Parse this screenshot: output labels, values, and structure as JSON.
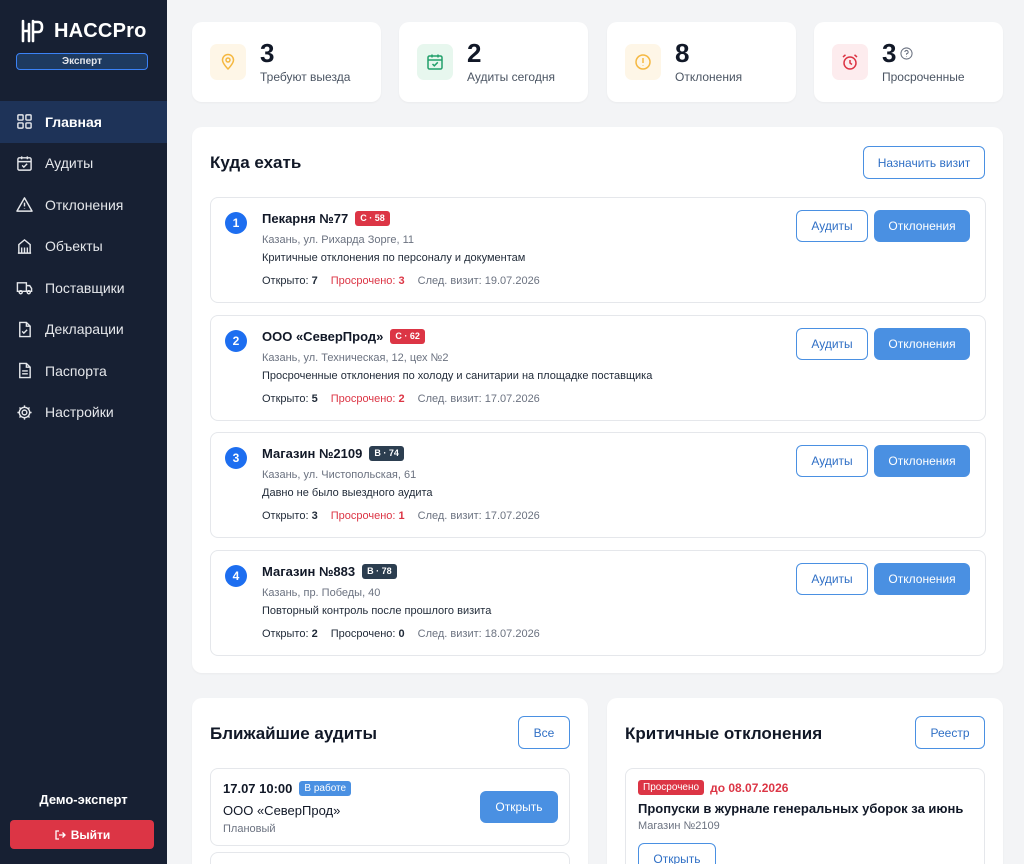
{
  "app": {
    "name": "HACCPro",
    "role": "Эксперт"
  },
  "sidebar": {
    "items": [
      {
        "label": "Главная",
        "icon": "grid-icon",
        "active": true
      },
      {
        "label": "Аудиты",
        "icon": "calendar-check-icon"
      },
      {
        "label": "Отклонения",
        "icon": "warning-icon"
      },
      {
        "label": "Объекты",
        "icon": "building-icon"
      },
      {
        "label": "Поставщики",
        "icon": "truck-icon"
      },
      {
        "label": "Декларации",
        "icon": "document-check-icon"
      },
      {
        "label": "Паспорта",
        "icon": "document-icon"
      },
      {
        "label": "Настройки",
        "icon": "gear-icon"
      }
    ],
    "user_name": "Демо-эксперт",
    "logout_label": "Выйти"
  },
  "stats": [
    {
      "value": "3",
      "label": "Требуют выезда",
      "icon": "map-pin-icon",
      "color": "#f5b841",
      "bg": "#fef6e7"
    },
    {
      "value": "2",
      "label": "Аудиты сегодня",
      "icon": "calendar-check-icon",
      "color": "#22a06b",
      "bg": "#e7f7ee"
    },
    {
      "value": "8",
      "label": "Отклонения",
      "icon": "alert-circle-icon",
      "color": "#f5b841",
      "bg": "#fef6e7"
    },
    {
      "value": "3",
      "label": "Просроченные",
      "icon": "alarm-clock-icon",
      "color": "#dc3545",
      "bg": "#fdecee"
    }
  ],
  "visits_panel": {
    "title": "Куда ехать",
    "assign_label": "Назначить визит",
    "audits_label": "Аудиты",
    "deviations_label": "Отклонения",
    "open_label": "Открыто:",
    "overdue_label": "Просрочено:",
    "next_label": "След. визит:",
    "items": [
      {
        "num": "1",
        "name": "Пекарня №77",
        "grade": "C · 58",
        "grade_class": "c",
        "address": "Казань, ул. Рихарда Зорге, 11",
        "reason": "Критичные отклонения по персоналу и документам",
        "open": "7",
        "overdue": "3",
        "overdue_highlight": true,
        "next": "19.07.2026"
      },
      {
        "num": "2",
        "name": "ООО «СеверПрод»",
        "grade": "C · 62",
        "grade_class": "c",
        "address": "Казань, ул. Техническая, 12, цех №2",
        "reason": "Просроченные отклонения по холоду и санитарии на площадке поставщика",
        "open": "5",
        "overdue": "2",
        "overdue_highlight": true,
        "next": "17.07.2026"
      },
      {
        "num": "3",
        "name": "Магазин №2109",
        "grade": "B · 74",
        "grade_class": "b",
        "address": "Казань, ул. Чистопольская, 61",
        "reason": "Давно не было выездного аудита",
        "open": "3",
        "overdue": "1",
        "overdue_highlight": true,
        "next": "17.07.2026"
      },
      {
        "num": "4",
        "name": "Магазин №883",
        "grade": "B · 78",
        "grade_class": "b",
        "address": "Казань, пр. Победы, 40",
        "reason": "Повторный контроль после прошлого визита",
        "open": "2",
        "overdue": "0",
        "overdue_highlight": false,
        "next": "18.07.2026"
      }
    ]
  },
  "audits_panel": {
    "title": "Ближайшие аудиты",
    "all_label": "Все",
    "items": [
      {
        "datetime": "17.07 10:00",
        "status": "В работе",
        "org": "ООО «СеверПрод»",
        "type": "Плановый",
        "open_label": "Открыть"
      }
    ]
  },
  "deviations_panel": {
    "title": "Критичные отклонения",
    "registry_label": "Реестр",
    "items": [
      {
        "status": "Просрочено",
        "due": "до 08.07.2026",
        "title": "Пропуски в журнале генеральных уборок за июнь",
        "object": "Магазин №2109",
        "open_label": "Открыть"
      }
    ]
  }
}
